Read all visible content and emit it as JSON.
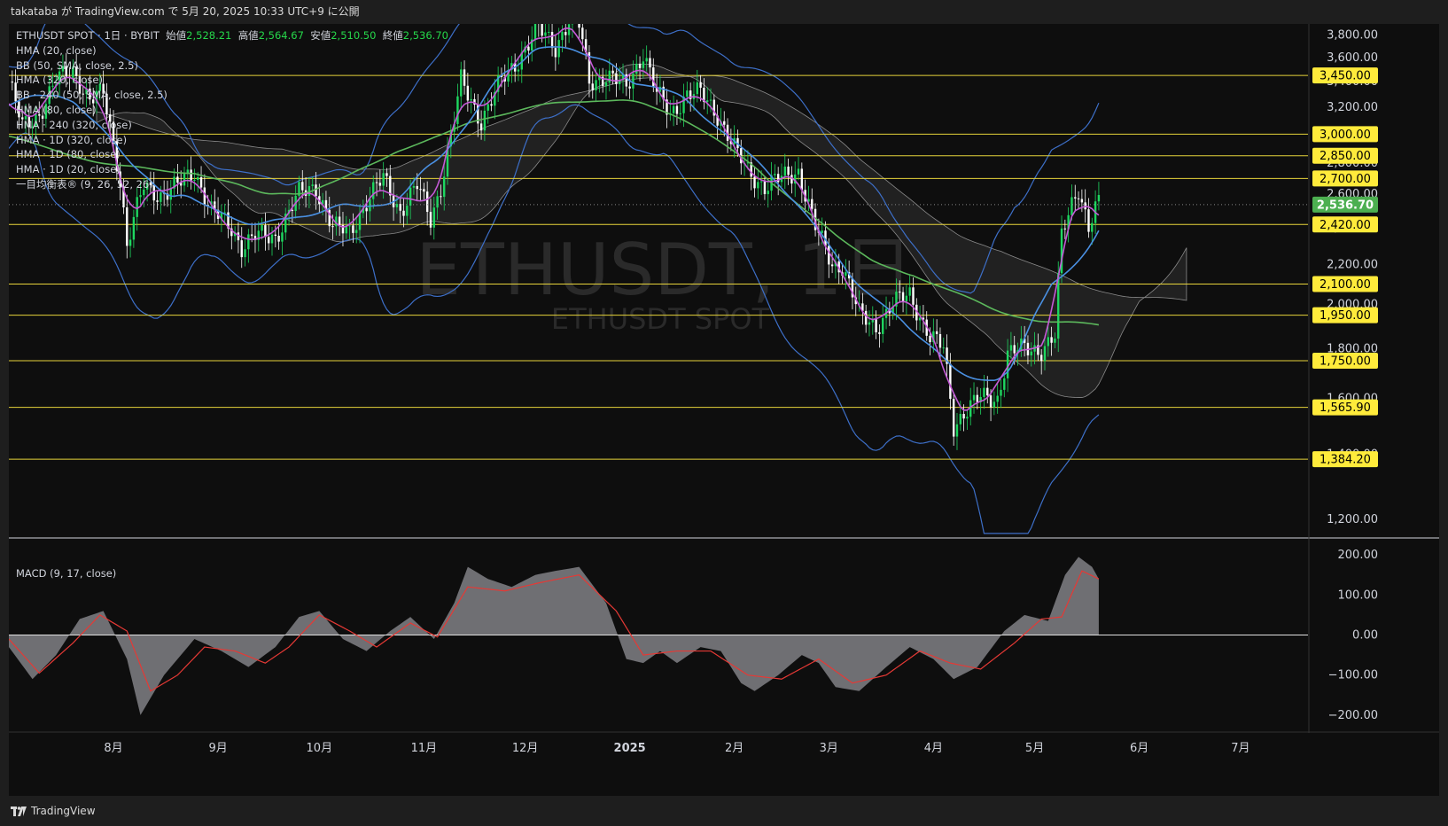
{
  "header": {
    "publish_text": "takataba が TradingView.com で 5月 20, 2025 10:33 UTC+9 に公開"
  },
  "footer": {
    "brand": "TradingView",
    "logo_icon": "tradingview-logo-icon"
  },
  "legend": {
    "symbol": "ETHUSDT SPOT · 1日 · BYBIT",
    "o_label": "始値",
    "o": "2,528.21",
    "h_label": "高値",
    "h": "2,564.67",
    "l_label": "安値",
    "l": "2,510.50",
    "c_label": "終値",
    "c": "2,536.70",
    "indicators": [
      "HMA (20, close)",
      "BB (50, SMA, close, 2.5)",
      "HMA (320, close)",
      "BB · 240 (50, SMA, close, 2.5)",
      "HMA (80, close)",
      "HMA · 240 (320, close)",
      "HMA · 1D (320, close)",
      "HMA · 1D (80, close)",
      "HMA · 1D (20, close)",
      "一目均衡表® (9, 26, 52, 26)"
    ]
  },
  "watermark": {
    "big": "ETHUSDT, 1日",
    "small": "ETHUSDT SPOT"
  },
  "macd_label": "MACD (9, 17, close)",
  "chart_data": {
    "type": "candlestick",
    "price_axis": {
      "ticks": [
        1200,
        1400,
        1600,
        1800,
        2000,
        2200,
        2400,
        2600,
        2800,
        3000,
        3200,
        3400,
        3600,
        3800
      ],
      "tick_labels": [
        "1,200.00",
        "1,400.00",
        "1,600.00",
        "1,800.00",
        "2,000.00",
        "2,200.00",
        "2,400.00",
        "2,600.00",
        "2,800.00",
        "3,000.00",
        "3,200.00",
        "3,400.00",
        "3,600.00",
        "3,800.00"
      ],
      "range": [
        1150,
        3900
      ],
      "scale": "log"
    },
    "time_axis": {
      "labels": [
        "8月",
        "9月",
        "10月",
        "11月",
        "12月",
        "2025",
        "2月",
        "3月",
        "4月",
        "5月",
        "6月",
        "7月"
      ],
      "dates": [
        "2024-08-01",
        "2024-09-01",
        "2024-10-01",
        "2024-11-01",
        "2024-12-01",
        "2025-01-01",
        "2025-02-01",
        "2025-03-01",
        "2025-04-01",
        "2025-05-01",
        "2025-06-01",
        "2025-07-01"
      ],
      "range": [
        "2024-07-01",
        "2025-07-21"
      ]
    },
    "horizontal_levels": [
      {
        "value": 3450,
        "label": "3,450.00"
      },
      {
        "value": 3000,
        "label": "3,000.00"
      },
      {
        "value": 2850,
        "label": "2,850.00"
      },
      {
        "value": 2700,
        "label": "2,700.00"
      },
      {
        "value": 2420,
        "label": "2,420.00"
      },
      {
        "value": 2100,
        "label": "2,100.00"
      },
      {
        "value": 1950,
        "label": "1,950.00"
      },
      {
        "value": 1750,
        "label": "1,750.00"
      },
      {
        "value": 1565.9,
        "label": "1,565.90"
      },
      {
        "value": 1384.2,
        "label": "1,384.20"
      }
    ],
    "last_price": {
      "value": 2536.7,
      "label": "2,536.70",
      "color": "#4caf50"
    },
    "price_path": [
      [
        "2024-07-01",
        3400
      ],
      [
        "2024-07-05",
        3050
      ],
      [
        "2024-07-10",
        3150
      ],
      [
        "2024-07-15",
        3400
      ],
      [
        "2024-07-20",
        3500
      ],
      [
        "2024-07-25",
        3250
      ],
      [
        "2024-07-29",
        3300
      ],
      [
        "2024-08-03",
        2700
      ],
      [
        "2024-08-05",
        2300
      ],
      [
        "2024-08-10",
        2650
      ],
      [
        "2024-08-15",
        2600
      ],
      [
        "2024-08-20",
        2650
      ],
      [
        "2024-08-25",
        2750
      ],
      [
        "2024-08-30",
        2500
      ],
      [
        "2024-09-05",
        2400
      ],
      [
        "2024-09-08",
        2300
      ],
      [
        "2024-09-12",
        2350
      ],
      [
        "2024-09-18",
        2350
      ],
      [
        "2024-09-25",
        2600
      ],
      [
        "2024-09-30",
        2650
      ],
      [
        "2024-10-05",
        2400
      ],
      [
        "2024-10-10",
        2380
      ],
      [
        "2024-10-15",
        2550
      ],
      [
        "2024-10-20",
        2700
      ],
      [
        "2024-10-25",
        2500
      ],
      [
        "2024-10-30",
        2650
      ],
      [
        "2024-11-03",
        2450
      ],
      [
        "2024-11-06",
        2650
      ],
      [
        "2024-11-10",
        3100
      ],
      [
        "2024-11-12",
        3400
      ],
      [
        "2024-11-18",
        3100
      ],
      [
        "2024-11-24",
        3400
      ],
      [
        "2024-11-28",
        3550
      ],
      [
        "2024-12-05",
        3850
      ],
      [
        "2024-12-10",
        3700
      ],
      [
        "2024-12-16",
        4050
      ],
      [
        "2024-12-20",
        3400
      ],
      [
        "2024-12-25",
        3450
      ],
      [
        "2024-12-31",
        3350
      ],
      [
        "2025-01-05",
        3650
      ],
      [
        "2025-01-09",
        3300
      ],
      [
        "2025-01-13",
        3150
      ],
      [
        "2025-01-18",
        3300
      ],
      [
        "2025-01-22",
        3300
      ],
      [
        "2025-01-27",
        3150
      ],
      [
        "2025-02-02",
        2850
      ],
      [
        "2025-02-05",
        2750
      ],
      [
        "2025-02-10",
        2650
      ],
      [
        "2025-02-15",
        2700
      ],
      [
        "2025-02-20",
        2750
      ],
      [
        "2025-02-25",
        2400
      ],
      [
        "2025-03-02",
        2200
      ],
      [
        "2025-03-05",
        2200
      ],
      [
        "2025-03-10",
        1950
      ],
      [
        "2025-03-15",
        1900
      ],
      [
        "2025-03-20",
        2000
      ],
      [
        "2025-03-25",
        2050
      ],
      [
        "2025-03-31",
        1850
      ],
      [
        "2025-04-04",
        1800
      ],
      [
        "2025-04-07",
        1500
      ],
      [
        "2025-04-10",
        1550
      ],
      [
        "2025-04-15",
        1600
      ],
      [
        "2025-04-20",
        1600
      ],
      [
        "2025-04-23",
        1780
      ],
      [
        "2025-04-28",
        1800
      ],
      [
        "2025-05-03",
        1800
      ],
      [
        "2025-05-07",
        1850
      ],
      [
        "2025-05-09",
        2350
      ],
      [
        "2025-05-12",
        2550
      ],
      [
        "2025-05-14",
        2650
      ],
      [
        "2025-05-17",
        2400
      ],
      [
        "2025-05-19",
        2500
      ],
      [
        "2025-05-20",
        2536.7
      ]
    ],
    "macd": {
      "axis_ticks": [
        -200,
        -100,
        0,
        100,
        200
      ],
      "tick_labels": [
        "−200.00",
        "−100.00",
        "0.00",
        "100.00",
        "200.00"
      ],
      "range": [
        -240,
        240
      ],
      "histogram": [
        [
          "2024-07-01",
          -30
        ],
        [
          "2024-07-08",
          -110
        ],
        [
          "2024-07-15",
          -50
        ],
        [
          "2024-07-22",
          40
        ],
        [
          "2024-07-29",
          60
        ],
        [
          "2024-08-05",
          -60
        ],
        [
          "2024-08-09",
          -200
        ],
        [
          "2024-08-16",
          -100
        ],
        [
          "2024-08-25",
          -10
        ],
        [
          "2024-09-02",
          -40
        ],
        [
          "2024-09-10",
          -80
        ],
        [
          "2024-09-18",
          -30
        ],
        [
          "2024-09-25",
          45
        ],
        [
          "2024-10-01",
          60
        ],
        [
          "2024-10-08",
          -10
        ],
        [
          "2024-10-15",
          -40
        ],
        [
          "2024-10-22",
          10
        ],
        [
          "2024-10-28",
          45
        ],
        [
          "2024-11-04",
          -10
        ],
        [
          "2024-11-10",
          80
        ],
        [
          "2024-11-14",
          170
        ],
        [
          "2024-11-20",
          140
        ],
        [
          "2024-11-27",
          120
        ],
        [
          "2024-12-04",
          150
        ],
        [
          "2024-12-10",
          160
        ],
        [
          "2024-12-17",
          170
        ],
        [
          "2024-12-25",
          80
        ],
        [
          "2024-12-31",
          -60
        ],
        [
          "2025-01-05",
          -70
        ],
        [
          "2025-01-10",
          -40
        ],
        [
          "2025-01-15",
          -70
        ],
        [
          "2025-01-22",
          -30
        ],
        [
          "2025-01-28",
          -40
        ],
        [
          "2025-02-03",
          -120
        ],
        [
          "2025-02-07",
          -140
        ],
        [
          "2025-02-14",
          -100
        ],
        [
          "2025-02-21",
          -50
        ],
        [
          "2025-02-26",
          -70
        ],
        [
          "2025-03-03",
          -130
        ],
        [
          "2025-03-10",
          -140
        ],
        [
          "2025-03-18",
          -80
        ],
        [
          "2025-03-25",
          -30
        ],
        [
          "2025-04-01",
          -60
        ],
        [
          "2025-04-07",
          -110
        ],
        [
          "2025-04-14",
          -80
        ],
        [
          "2025-04-22",
          10
        ],
        [
          "2025-04-28",
          50
        ],
        [
          "2025-05-05",
          35
        ],
        [
          "2025-05-10",
          150
        ],
        [
          "2025-05-14",
          195
        ],
        [
          "2025-05-18",
          170
        ],
        [
          "2025-05-20",
          140
        ]
      ],
      "signal": [
        [
          "2024-07-01",
          -10
        ],
        [
          "2024-07-10",
          -95
        ],
        [
          "2024-07-20",
          -20
        ],
        [
          "2024-07-28",
          50
        ],
        [
          "2024-08-05",
          10
        ],
        [
          "2024-08-12",
          -140
        ],
        [
          "2024-08-20",
          -100
        ],
        [
          "2024-08-28",
          -30
        ],
        [
          "2024-09-06",
          -40
        ],
        [
          "2024-09-15",
          -70
        ],
        [
          "2024-09-22",
          -30
        ],
        [
          "2024-10-01",
          50
        ],
        [
          "2024-10-10",
          10
        ],
        [
          "2024-10-18",
          -30
        ],
        [
          "2024-10-28",
          30
        ],
        [
          "2024-11-05",
          -5
        ],
        [
          "2024-11-14",
          120
        ],
        [
          "2024-11-25",
          110
        ],
        [
          "2024-12-05",
          130
        ],
        [
          "2024-12-17",
          150
        ],
        [
          "2024-12-28",
          60
        ],
        [
          "2025-01-05",
          -50
        ],
        [
          "2025-01-15",
          -40
        ],
        [
          "2025-01-25",
          -40
        ],
        [
          "2025-02-05",
          -100
        ],
        [
          "2025-02-15",
          -110
        ],
        [
          "2025-02-26",
          -60
        ],
        [
          "2025-03-08",
          -120
        ],
        [
          "2025-03-18",
          -100
        ],
        [
          "2025-03-28",
          -40
        ],
        [
          "2025-04-06",
          -70
        ],
        [
          "2025-04-15",
          -85
        ],
        [
          "2025-04-25",
          -20
        ],
        [
          "2025-05-03",
          40
        ],
        [
          "2025-05-09",
          45
        ],
        [
          "2025-05-15",
          160
        ],
        [
          "2025-05-20",
          140
        ]
      ]
    },
    "colors": {
      "up": "#1ed760",
      "down": "#ffffff",
      "level": "#e6d33a",
      "hma_fast": "#c45ad6",
      "hma_mid": "#4a90e2",
      "hma_slow": "#5cb85c",
      "bb": "#3d6fc8",
      "macd_signal": "#e53935"
    }
  }
}
